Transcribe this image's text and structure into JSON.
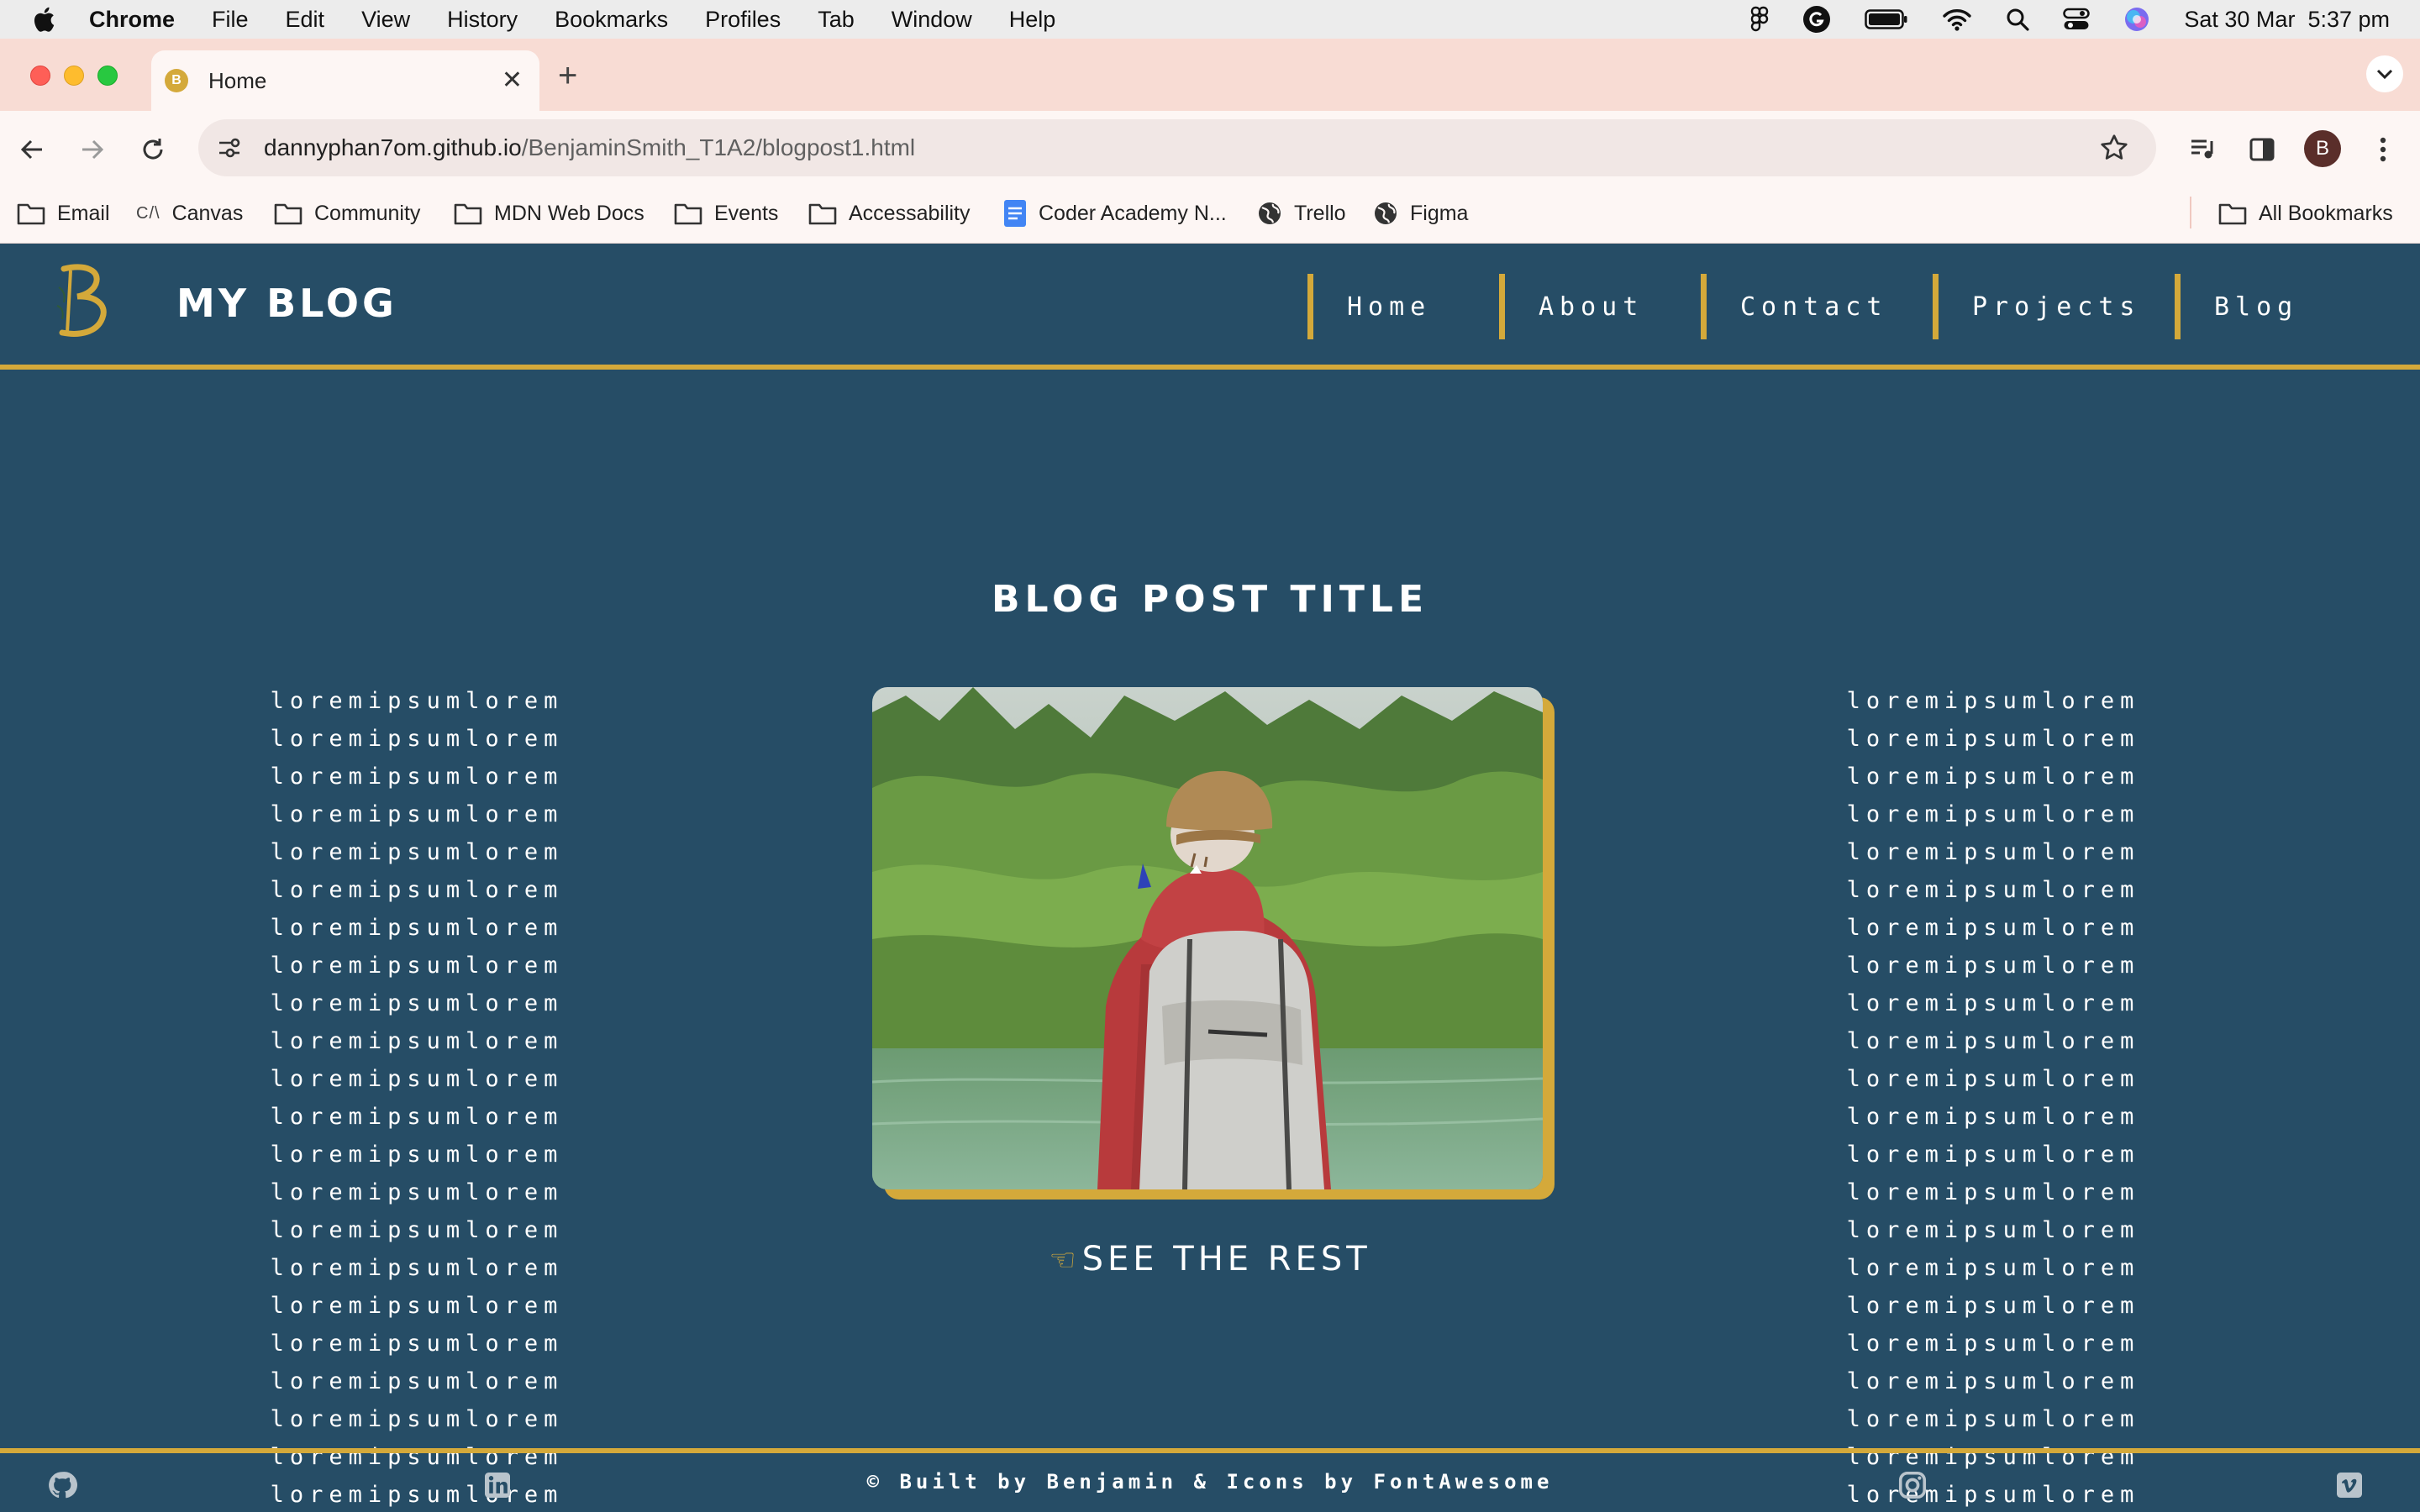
{
  "menubar": {
    "app": "Chrome",
    "items": [
      "File",
      "Edit",
      "View",
      "History",
      "Bookmarks",
      "Profiles",
      "Tab",
      "Window",
      "Help"
    ],
    "datetime": "Sat 30 Mar  5:37 pm"
  },
  "tab": {
    "title": "Home",
    "favicon_letter": "B"
  },
  "address": {
    "host": "dannyphan7om.github.io",
    "path": "/BenjaminSmith_T1A2/blogpost1.html"
  },
  "profile_initial": "B",
  "bookmarks": [
    {
      "label": "Email",
      "icon": "folder-icon"
    },
    {
      "label": "Canvas",
      "icon": "canvas-icon"
    },
    {
      "label": "Community",
      "icon": "folder-icon"
    },
    {
      "label": "MDN Web Docs",
      "icon": "folder-icon"
    },
    {
      "label": "Events",
      "icon": "folder-icon"
    },
    {
      "label": "Accessability",
      "icon": "folder-icon"
    },
    {
      "label": "Coder Academy N...",
      "icon": "docs-icon"
    },
    {
      "label": "Trello",
      "icon": "globe-icon"
    },
    {
      "label": "Figma",
      "icon": "globe-icon"
    }
  ],
  "all_bookmarks": "All Bookmarks",
  "site": {
    "brand": "MY BLOG",
    "nav": [
      "Home",
      "About",
      "Contact",
      "Projects",
      "Blog"
    ],
    "post_title": "BLOG POST TITLE",
    "lorem_lines": [
      "loremipsumlorem loremipsumlorem",
      "loremipsumlorem loremipsumlorem",
      "loremipsumlorem loremipsumlorem",
      "loremipsumlorem loremipsumlorem",
      "loremipsumlorem loremipsumlorem",
      "loremipsumlorem loremipsumlorem",
      "loremipsumlorem loremipsumlorem",
      "loremipsumlorem loremipsumlorem",
      "loremipsumlorem loremipsumlorem",
      "loremipsumlorem loremipsumlorem",
      "loremipsumlorem loremipsumlorem",
      "loremipsumlorem"
    ],
    "see_rest": "SEE THE REST",
    "footer": "© Built by Benjamin & Icons by FontAwesome"
  },
  "colors": {
    "page_bg": "#264d66",
    "accent": "#d4a93a"
  }
}
